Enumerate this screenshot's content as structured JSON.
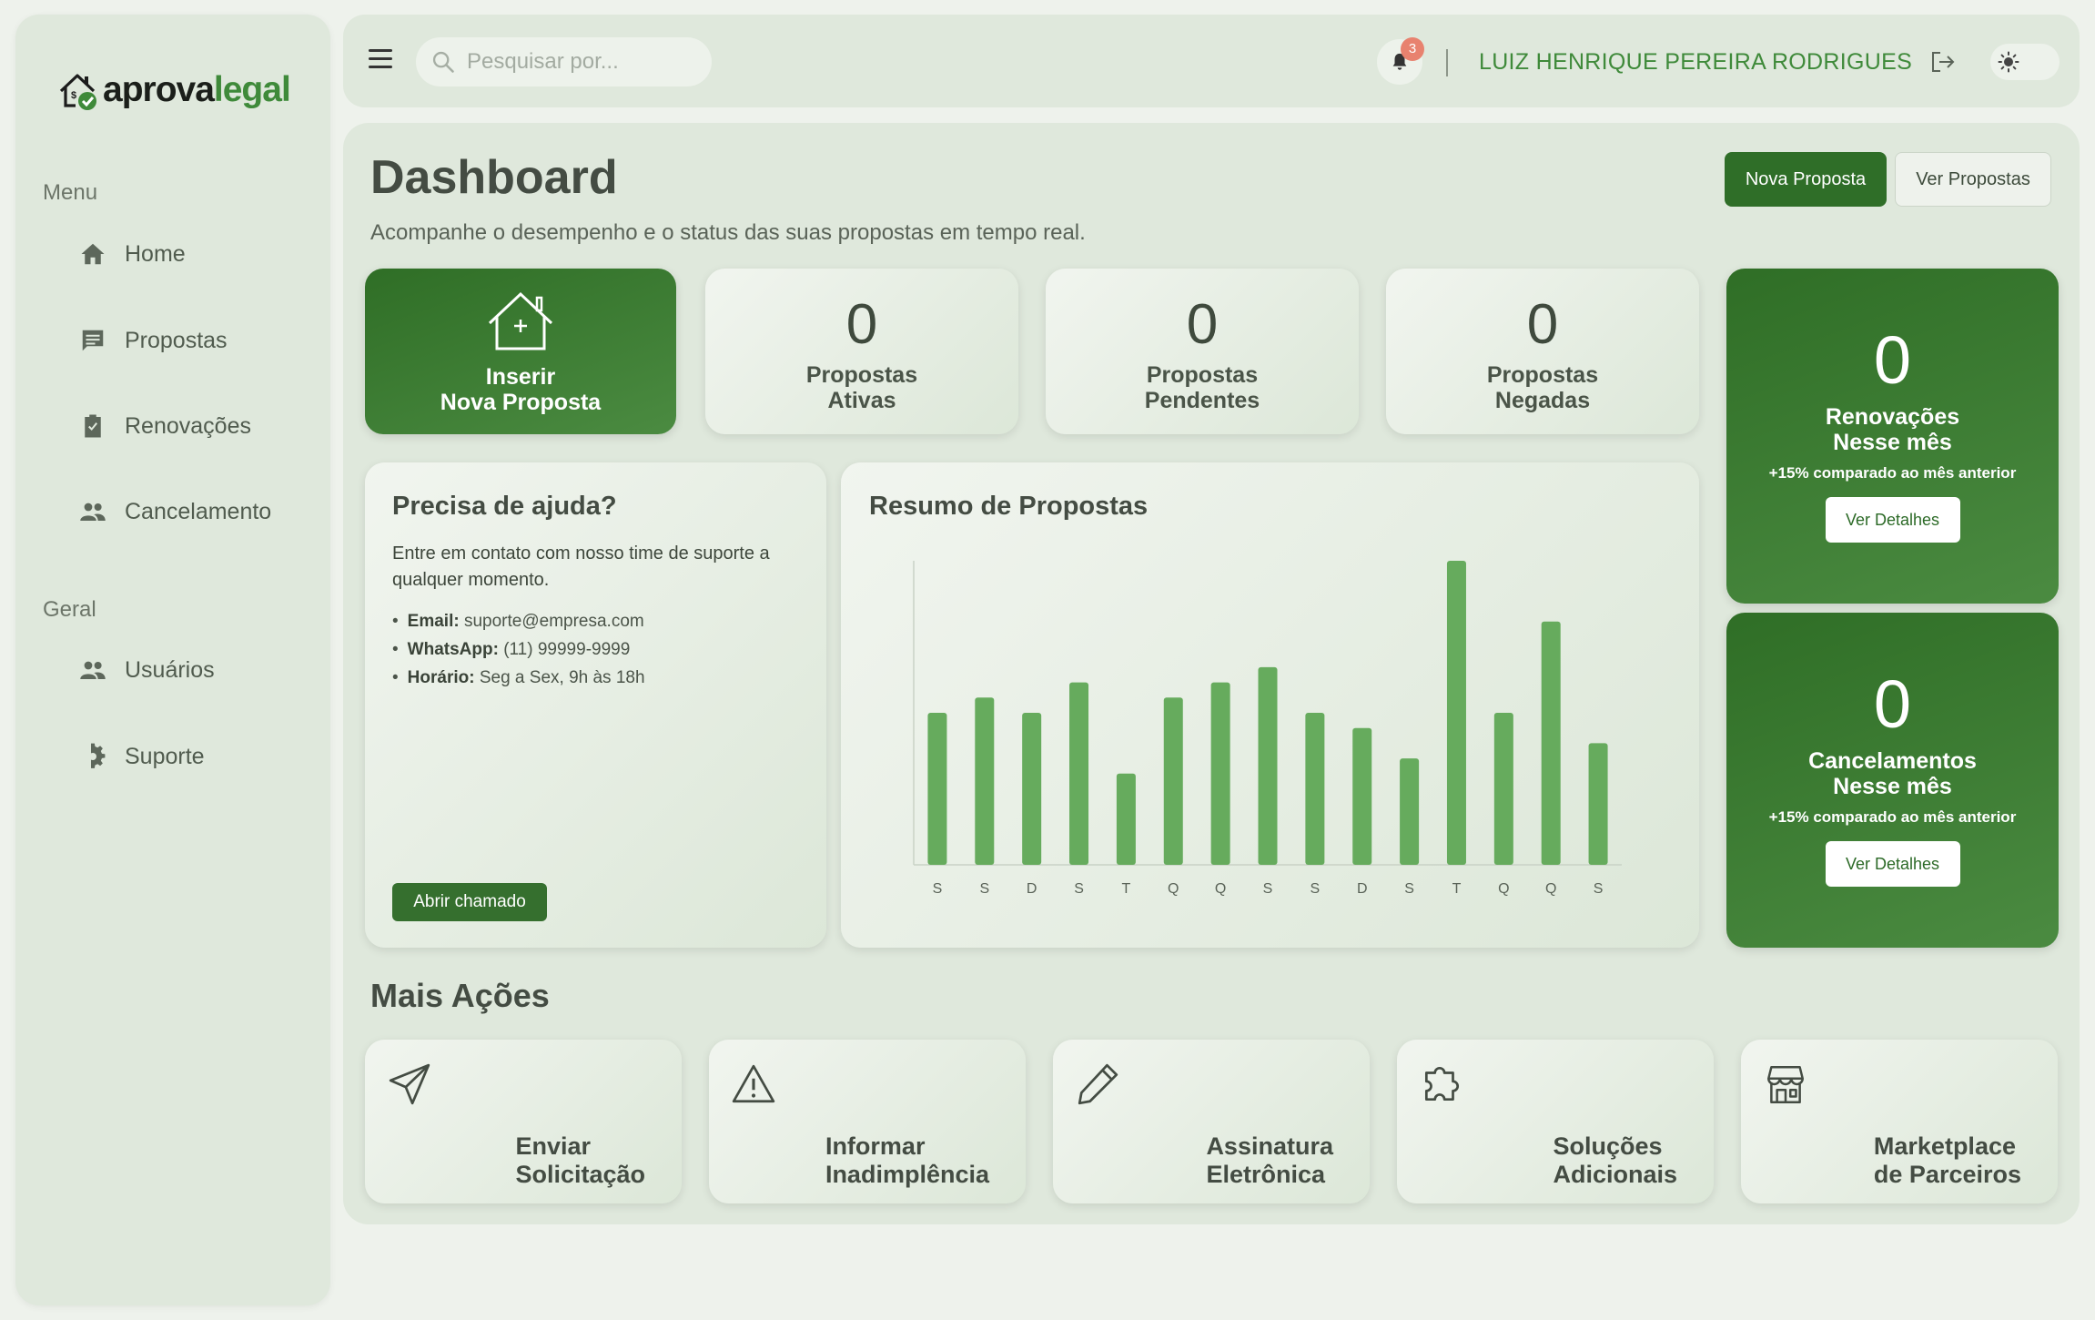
{
  "brand": {
    "name_part1": "aprova",
    "name_part2": "legal"
  },
  "sidebar": {
    "menu_title": "Menu",
    "menu_items": [
      {
        "label": "Home",
        "icon": "home-icon"
      },
      {
        "label": "Propostas",
        "icon": "chat-icon"
      },
      {
        "label": "Renovações",
        "icon": "clipboard-check-icon"
      },
      {
        "label": "Cancelamento",
        "icon": "users-icon"
      }
    ],
    "general_title": "Geral",
    "general_items": [
      {
        "label": "Usuários",
        "icon": "users-icon"
      },
      {
        "label": "Suporte",
        "icon": "gear-icon"
      }
    ]
  },
  "topbar": {
    "search_placeholder": "Pesquisar por...",
    "notification_count": "3",
    "username": "LUIZ HENRIQUE PEREIRA RODRIGUES"
  },
  "header": {
    "title": "Dashboard",
    "subtitle": "Acompanhe o desempenho e o status das suas propostas em tempo real.",
    "primary_button": "Nova Proposta",
    "secondary_button": "Ver Propostas"
  },
  "stats": {
    "insert": {
      "line1": "Inserir",
      "line2": "Nova Proposta"
    },
    "active": {
      "value": "0",
      "line1": "Propostas",
      "line2": "Ativas"
    },
    "pending": {
      "value": "0",
      "line1": "Propostas",
      "line2": "Pendentes"
    },
    "denied": {
      "value": "0",
      "line1": "Propostas",
      "line2": "Negadas"
    }
  },
  "side_cards": {
    "renewals": {
      "value": "0",
      "line1": "Renovações",
      "line2": "Nesse mês",
      "note": "+15% comparado ao mês anterior",
      "button": "Ver Detalhes"
    },
    "cancellations": {
      "value": "0",
      "line1": "Cancelamentos",
      "line2": "Nesse mês",
      "note": "+15% comparado ao mês anterior",
      "button": "Ver Detalhes"
    }
  },
  "help": {
    "title": "Precisa de ajuda?",
    "text": "Entre em contato com nosso time de suporte a qualquer momento.",
    "email_label": "Email:",
    "email_value": "suporte@empresa.com",
    "whatsapp_label": "WhatsApp:",
    "whatsapp_value": "(11) 99999-9999",
    "hours_label": "Horário:",
    "hours_value": "Seg a Sex, 9h às 18h",
    "button": "Abrir chamado"
  },
  "chart_title": "Resumo de Propostas",
  "chart_data": {
    "type": "bar",
    "categories": [
      "S",
      "S",
      "D",
      "S",
      "T",
      "Q",
      "Q",
      "S",
      "S",
      "D",
      "S",
      "T",
      "Q",
      "Q",
      "S"
    ],
    "values": [
      50,
      55,
      50,
      60,
      30,
      55,
      60,
      65,
      50,
      45,
      35,
      100,
      50,
      80,
      40
    ],
    "ylim": [
      0,
      100
    ],
    "bar_color": "#66ab5d",
    "grid": false
  },
  "more_actions": {
    "title": "Mais Ações",
    "items": [
      {
        "line1": "Enviar",
        "line2": "Solicitação",
        "icon": "send-icon"
      },
      {
        "line1": "Informar",
        "line2": "Inadimplência",
        "icon": "warning-icon"
      },
      {
        "line1": "Assinatura",
        "line2": "Eletrônica",
        "icon": "pen-icon"
      },
      {
        "line1": "Soluções",
        "line2": "Adicionais",
        "icon": "puzzle-icon"
      },
      {
        "line1": "Marketplace",
        "line2": "de Parceiros",
        "icon": "store-icon"
      }
    ]
  },
  "colors": {
    "accent": "#2f6e28",
    "brand_green": "#3f8a3a",
    "badge": "#e8826f"
  }
}
